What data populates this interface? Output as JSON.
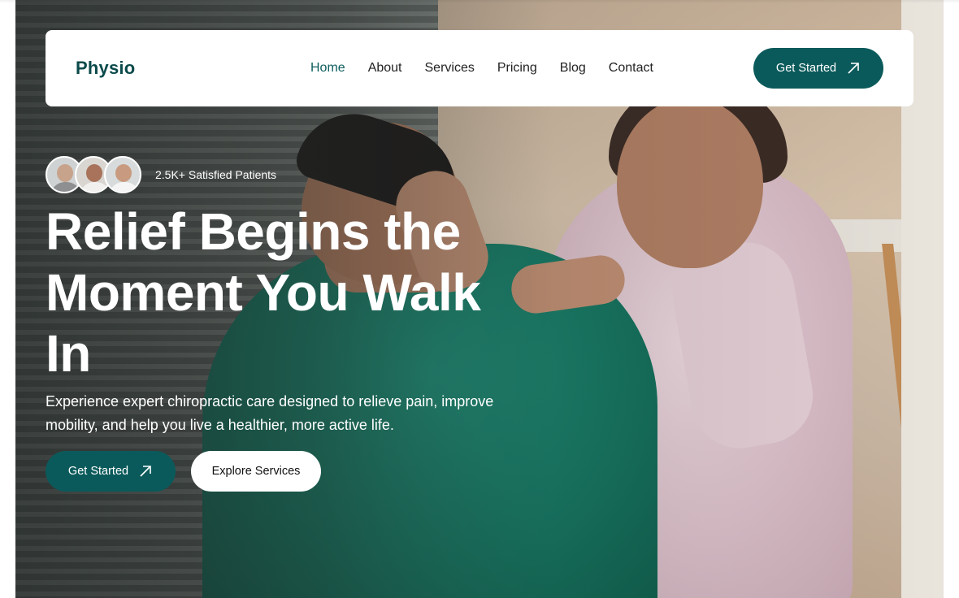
{
  "brand": {
    "logo": "Physio"
  },
  "nav": {
    "items": [
      {
        "label": "Home",
        "active": true
      },
      {
        "label": "About",
        "active": false
      },
      {
        "label": "Services",
        "active": false
      },
      {
        "label": "Pricing",
        "active": false
      },
      {
        "label": "Blog",
        "active": false
      },
      {
        "label": "Contact",
        "active": false
      }
    ],
    "cta_label": "Get Started",
    "cta_icon": "arrow-up-right-icon"
  },
  "hero": {
    "social_proof": "2.5K+ Satisfied Patients",
    "headline": "Relief Begins the Moment You Walk In",
    "description": "Experience expert chiropractic care designed to relieve pain, improve mobility, and help you live a healthier, more active life.",
    "primary_button": "Get Started",
    "secondary_button": "Explore Services"
  },
  "colors": {
    "accent": "#0b5a5b",
    "logo": "#0b4a4b",
    "active_nav": "#0f5e5f"
  }
}
